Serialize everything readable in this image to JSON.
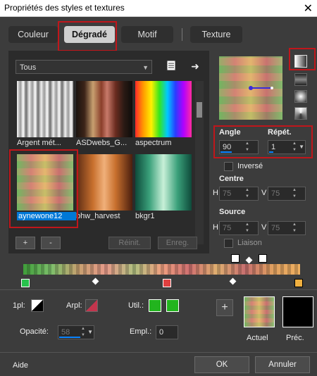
{
  "window": {
    "title": "Propriétés des styles et textures",
    "close_icon": "✕"
  },
  "tabs": [
    {
      "label": "Couleur",
      "active": false
    },
    {
      "label": "Dégradé",
      "active": true
    },
    {
      "label": "Motif",
      "active": false
    },
    {
      "label": "Texture",
      "active": false
    }
  ],
  "library": {
    "category": "Tous",
    "items": [
      {
        "label": "Argent mét..."
      },
      {
        "label": "ASDwebs_G..."
      },
      {
        "label": "aspectrum"
      },
      {
        "label": "aynewone12",
        "selected": true
      },
      {
        "label": "bhw_harvest"
      },
      {
        "label": "bkgr1"
      }
    ],
    "add_label": "+",
    "remove_label": "-",
    "reset_label": "Réinit.",
    "save_label": "Enreg."
  },
  "gradient": {
    "angle_label": "Angle",
    "angle_value": "90",
    "repeat_label": "Répét.",
    "repeat_value": "1",
    "invert_label": "Inversé",
    "center_label": "Centre",
    "center_h_label": "H",
    "center_h": "75",
    "center_v_label": "V",
    "center_v": "75",
    "source_label": "Source",
    "source_h_label": "H",
    "source_h": "75",
    "source_v_label": "V",
    "source_v": "75",
    "link_label": "Liaison"
  },
  "stop_props": {
    "opacity_label": "Opacité:",
    "opacity_value": "58",
    "arpl_label": "Arpl:",
    "pl1_label": "1pl:",
    "util_label": "Util.:",
    "empl_label": "Empl.:",
    "empl_value": "0",
    "util_color": "#22b41e"
  },
  "preview": {
    "actual_label": "Actuel",
    "previous_label": "Préc.",
    "add_label": "+"
  },
  "footer": {
    "help_label": "Aide",
    "ok_label": "OK",
    "cancel_label": "Annuler"
  },
  "colors": {
    "highlight": "#c0161b",
    "selection": "#0078d7"
  }
}
